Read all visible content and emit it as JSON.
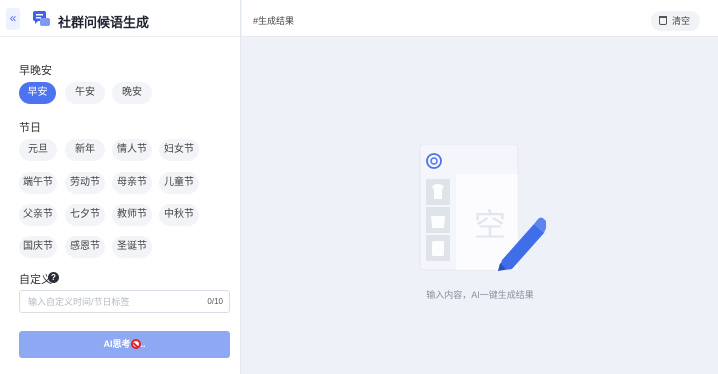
{
  "sidebar": {
    "collapse_glyph": "«",
    "title": "社群问候语生成",
    "logo_icon": "chat-bubble-icon"
  },
  "greeting": {
    "label": "早晚安",
    "options": [
      "早安",
      "午安",
      "晚安"
    ],
    "selected": "早安"
  },
  "festival": {
    "label": "节日",
    "options": [
      "元旦",
      "新年",
      "情人节",
      "妇女节",
      "端午节",
      "劳动节",
      "母亲节",
      "儿童节",
      "父亲节",
      "七夕节",
      "教师节",
      "中秋节",
      "国庆节",
      "感恩节",
      "圣诞节"
    ]
  },
  "custom": {
    "label": "自定义",
    "help_glyph": "?",
    "placeholder": "输入自定义时间/节日标签",
    "value": "",
    "counter": "0/10"
  },
  "generate_button": {
    "label": "AI思考"
  },
  "main": {
    "tab": "#生成结果",
    "clear_label": "清空",
    "empty_char": "空",
    "empty_hint": "输入内容，AI一键生成结果"
  },
  "colors": {
    "accent": "#4d74f0",
    "button_disabled": "#8fa8f4",
    "canvas_bg": "#eef1f8"
  }
}
